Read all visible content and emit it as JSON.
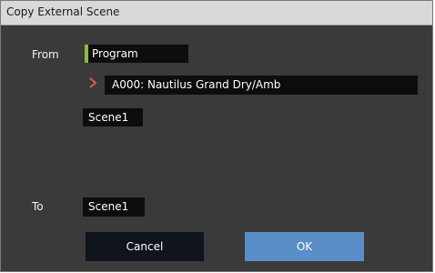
{
  "dialog": {
    "title": "Copy External Scene"
  },
  "from": {
    "label": "From",
    "source_type": "Program",
    "program": "A000: Nautilus Grand Dry/Amb",
    "scene": "Scene1"
  },
  "to": {
    "label": "To",
    "scene": "Scene1"
  },
  "buttons": {
    "cancel": "Cancel",
    "ok": "OK"
  },
  "colors": {
    "accent": "#8dbb3f",
    "chevron": "#e05a4f",
    "ok_button": "#5a8ec8"
  }
}
